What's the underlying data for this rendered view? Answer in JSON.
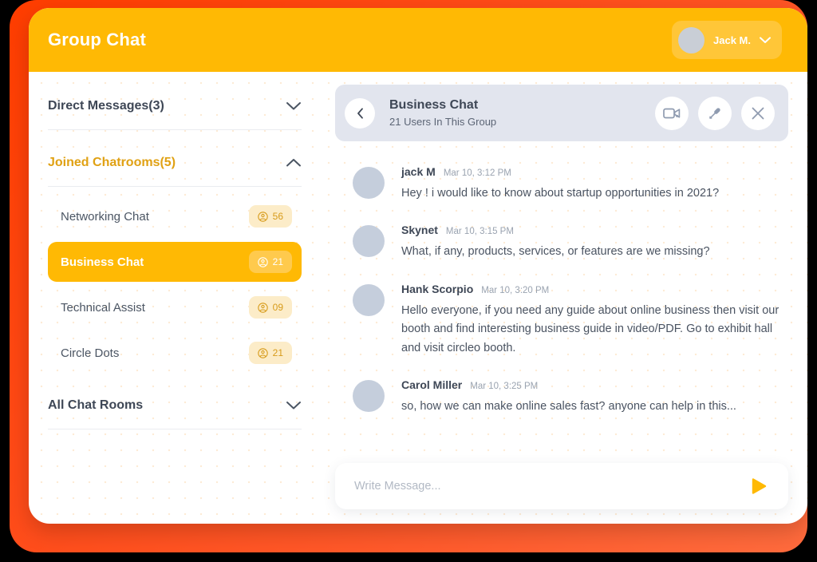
{
  "theme": {
    "accent": "#FFB904",
    "accent_dark": "#E0A113",
    "frame_orange": "#FF4A17",
    "chat_header_bg": "#E2E5EE",
    "avatar_gray": "#C5CEDC",
    "badge_bg": "#FCECC8",
    "text_dark": "#3E4756",
    "text_body": "#4A5361",
    "text_muted": "#9AA3B0"
  },
  "header": {
    "title": "Group Chat",
    "user": {
      "name": "Jack M.",
      "avatar_icon": "user-avatar",
      "chevron_icon": "chevron-down-icon"
    }
  },
  "sidebar": {
    "sections": [
      {
        "id": "direct-messages",
        "title": "Direct Messages(3)",
        "active": false,
        "expanded": false,
        "chevron_icon": "chevron-down-icon"
      },
      {
        "id": "joined-chatrooms",
        "title": "Joined Chatrooms(5)",
        "active": true,
        "expanded": true,
        "chevron_icon": "chevron-up-icon"
      },
      {
        "id": "all-chat-rooms",
        "title": "All Chat Rooms",
        "active": false,
        "expanded": false,
        "chevron_icon": "chevron-down-icon"
      }
    ],
    "rooms": [
      {
        "name": "Networking Chat",
        "count": "56",
        "selected": false,
        "badge_icon": "user-circle-icon"
      },
      {
        "name": "Business Chat",
        "count": "21",
        "selected": true,
        "badge_icon": "user-circle-icon"
      },
      {
        "name": "Technical Assist",
        "count": "09",
        "selected": false,
        "badge_icon": "user-circle-icon"
      },
      {
        "name": "Circle Dots",
        "count": "21",
        "selected": false,
        "badge_icon": "user-circle-icon"
      }
    ]
  },
  "chat": {
    "back_icon": "chevron-left-icon",
    "title": "Business Chat",
    "subtitle": "21 Users In This Group",
    "actions": [
      {
        "id": "video-call",
        "icon": "video-camera-icon"
      },
      {
        "id": "voice-record",
        "icon": "microphone-icon"
      },
      {
        "id": "close-chat",
        "icon": "close-icon"
      }
    ],
    "messages": [
      {
        "author": "jack M",
        "time": "Mar 10, 3:12 PM",
        "text": "Hey ! i would like to  know about startup opportunities in 2021?"
      },
      {
        "author": "Skynet",
        "time": "Mar 10, 3:15 PM",
        "text": "What, if any, products, services, or features are we missing?"
      },
      {
        "author": "Hank Scorpio",
        "time": "Mar 10, 3:20 PM",
        "text": "Hello everyone, if you need any guide about online business then visit our booth and find interesting business guide in video/PDF. Go to exhibit hall and visit circleo booth."
      },
      {
        "author": "Carol Miller",
        "time": "Mar 10, 3:25 PM",
        "text": "so, how we can make online sales fast? anyone can help in this..."
      }
    ],
    "composer": {
      "placeholder": "Write Message...",
      "value": "",
      "send_icon": "send-triangle-icon"
    }
  }
}
